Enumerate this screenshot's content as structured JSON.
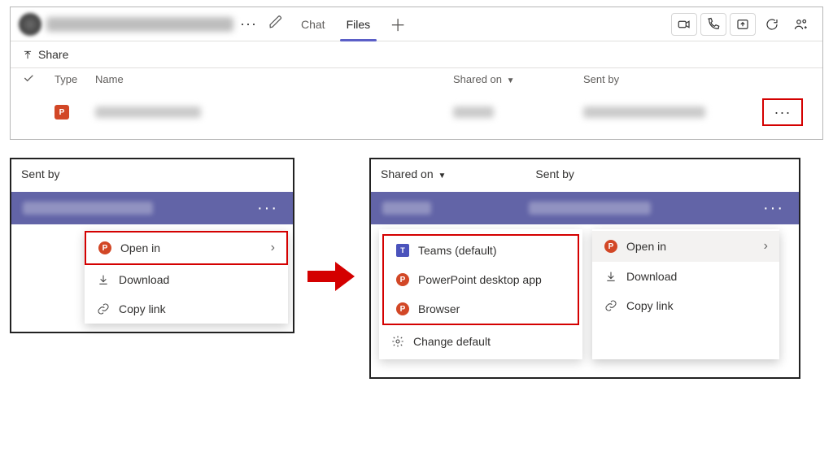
{
  "header": {
    "tab_chat": "Chat",
    "tab_files": "Files"
  },
  "share_label": "Share",
  "columns": {
    "type": "Type",
    "name": "Name",
    "shared": "Shared on",
    "sent": "Sent by"
  },
  "panel2": {
    "header": "Sent by",
    "menu": {
      "open": "Open in",
      "download": "Download",
      "copy": "Copy link"
    }
  },
  "panel3": {
    "shared": "Shared on",
    "sent": "Sent by",
    "open_options": {
      "teams": "Teams (default)",
      "desktop": "PowerPoint desktop app",
      "browser": "Browser",
      "change": "Change default"
    },
    "menu": {
      "open": "Open in",
      "download": "Download",
      "copy": "Copy link"
    }
  }
}
